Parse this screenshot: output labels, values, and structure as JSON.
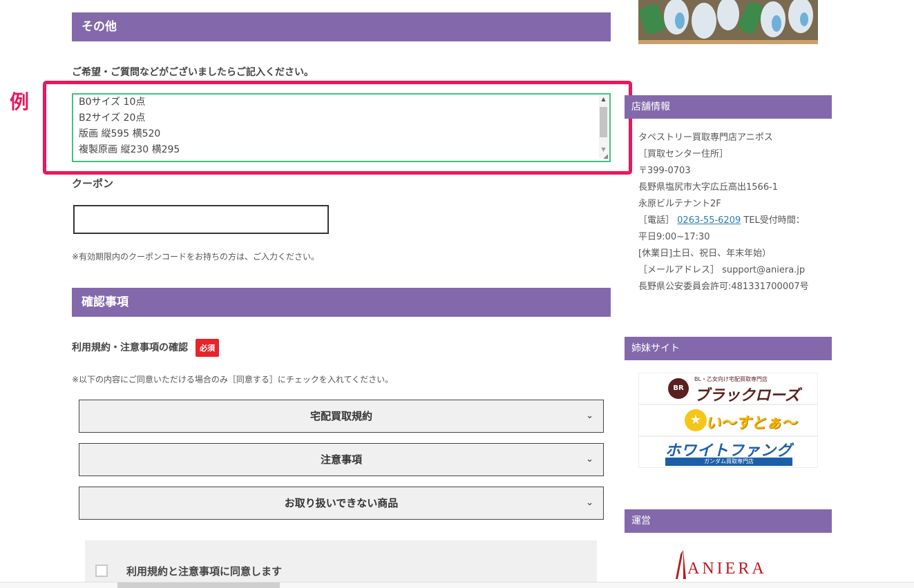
{
  "colors": {
    "header_purple": "#8369ab",
    "highlight_pink": "#e8185b",
    "required_red": "#e8232b",
    "textarea_border_green": "#3cc47a"
  },
  "other_section": {
    "title": "その他",
    "request_label": "ご希望・ご質問などがございましたらご記入ください。",
    "example_tag": "例",
    "textarea_lines": [
      "B0サイズ 10点",
      "B2サイズ 20点",
      "版画 縦595 横520",
      "複製原画 縦230 横295"
    ]
  },
  "coupon": {
    "label": "クーポン",
    "value": "",
    "note": "※有効期限内のクーポンコードをお持ちの方は、ご入力ください。"
  },
  "confirm_section": {
    "title": "確認事項",
    "terms_label": "利用規約・注意事項の確認",
    "required_badge": "必須",
    "note": "※以下の内容にご同意いただける場合のみ［同意する］にチェックを入れてください。",
    "accordions": [
      "宅配買取規約",
      "注意事項",
      "お取り扱いできない商品"
    ],
    "agree_label": "利用規約と注意事項に同意します"
  },
  "sidebar": {
    "shop_info": {
      "title": "店舗情報",
      "shop_name": "タペストリー買取専門店アニポス",
      "center_label": "［買取センター住所］",
      "postal": "〒399-0703",
      "address": "長野県塩尻市大字広丘高出1566-1",
      "building": "永原ビルテナント2F",
      "phone_prefix": "［電話］",
      "phone": "0263-55-6209",
      "phone_suffix": " TEL受付時間：",
      "hours": "平日9:00~17:30",
      "holidays": "[休業日]土日、祝日、年末年始）",
      "email": "［メールアドレス］ support@aniera.jp",
      "license": "長野県公安委員会許可:481331700007号"
    },
    "sister_sites": {
      "title": "姉妹サイト",
      "sites": [
        {
          "small": "BL・乙女向け宅配買取専門店",
          "name": "ブラックローズ",
          "icon": "rose-logo-icon"
        },
        {
          "name": "い〜すとぁ〜ど!",
          "icon": "star-logo-icon"
        },
        {
          "name": "ホワイトファング",
          "sub": "ガンダム買取専門店",
          "icon": "fang-logo-icon"
        }
      ]
    },
    "operator": {
      "title": "運営",
      "logo_text": "ANIERA"
    }
  }
}
